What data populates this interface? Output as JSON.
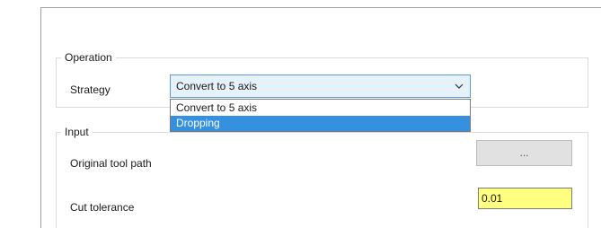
{
  "operation": {
    "legend": "Operation",
    "strategy_label": "Strategy",
    "strategy_value": "Convert to 5 axis",
    "strategy_options": [
      {
        "label": "Convert to 5 axis",
        "highlighted": false
      },
      {
        "label": "Dropping",
        "highlighted": true
      }
    ]
  },
  "input": {
    "legend": "Input",
    "original_tool_path_label": "Original tool path",
    "browse_button_label": "...",
    "cut_tolerance_label": "Cut tolerance",
    "cut_tolerance_value": "0.01"
  },
  "colors": {
    "combo_focus_border": "#5b9bd5",
    "selection_highlight": "#3590e0",
    "tolerance_field_bg": "#ffff80"
  },
  "icons": {
    "dropdown_arrow": "chevron-down-icon"
  }
}
